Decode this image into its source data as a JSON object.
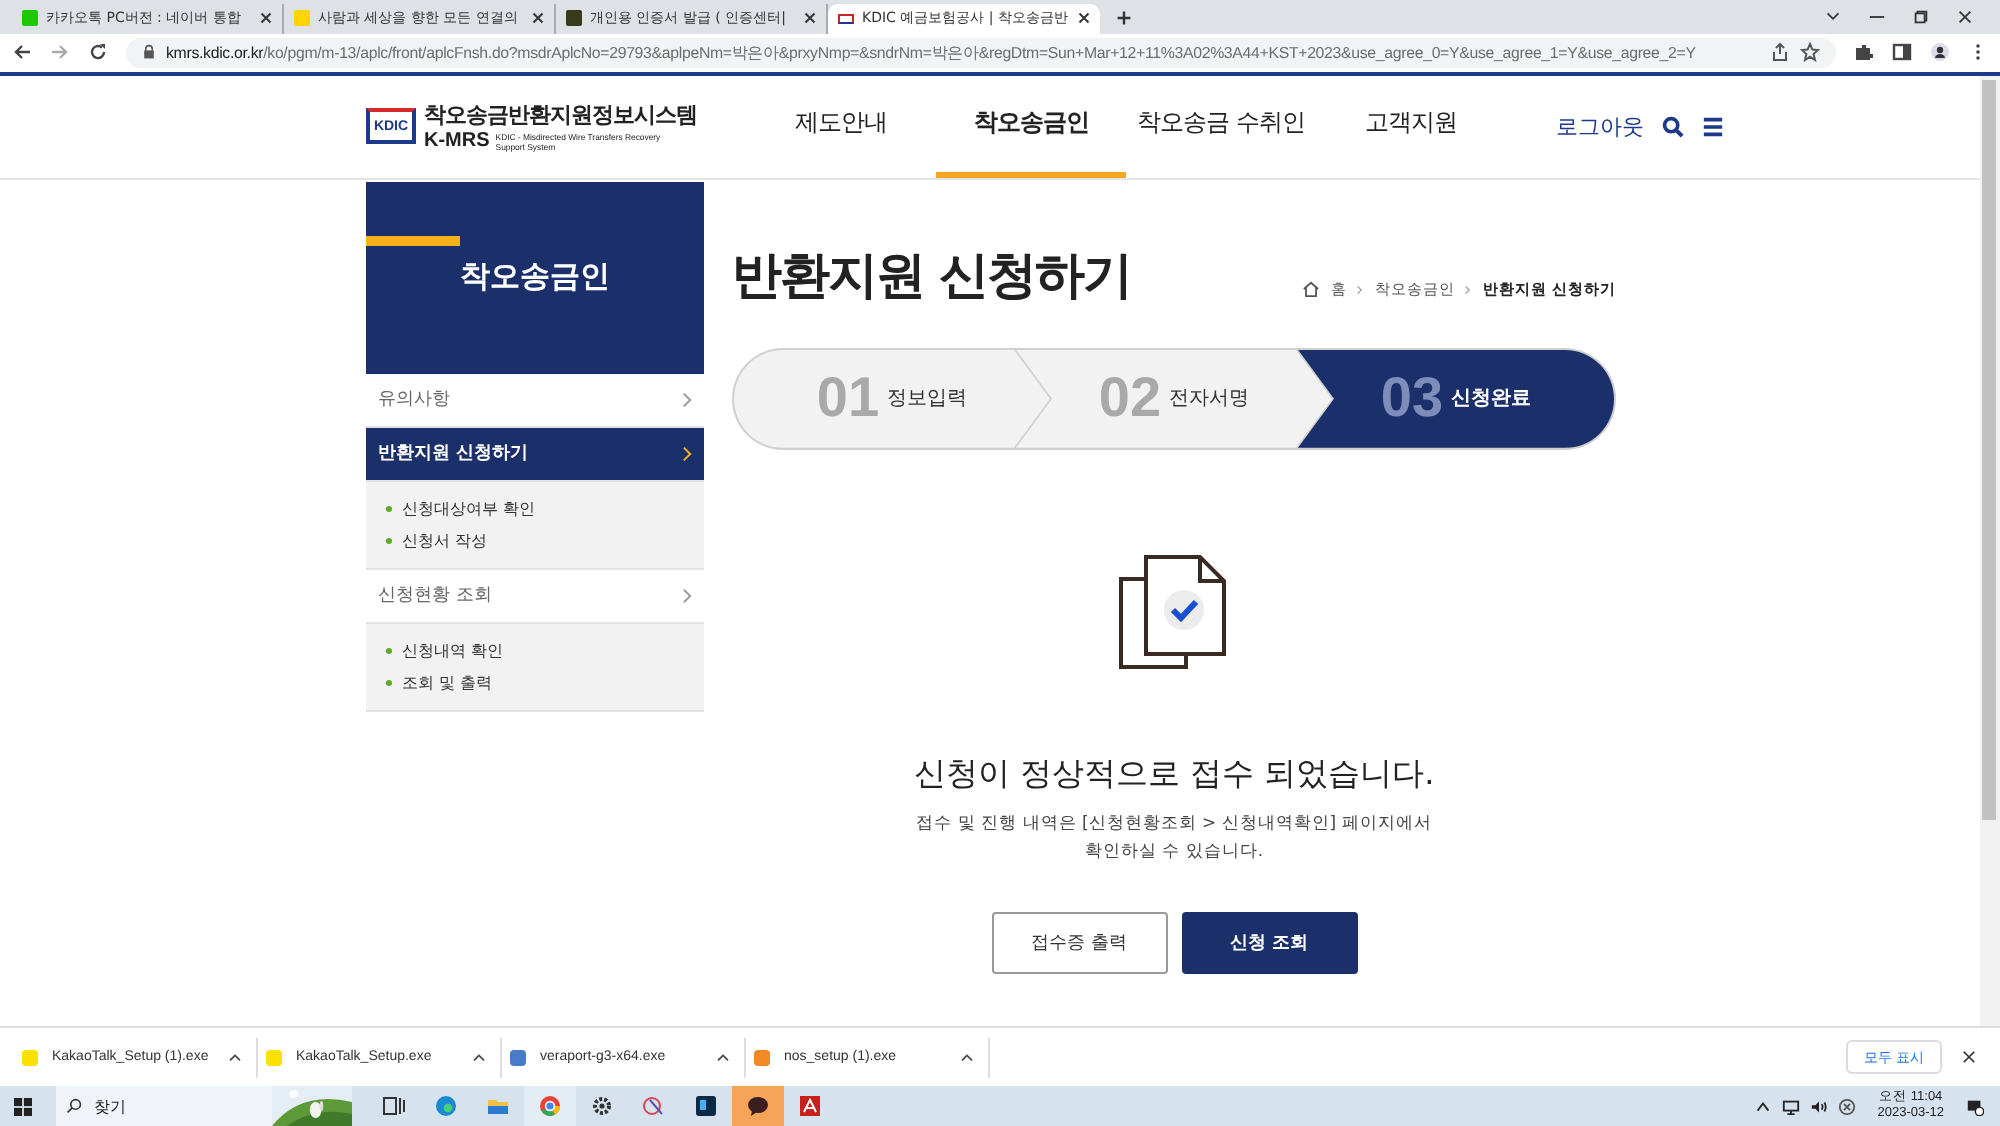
{
  "browser": {
    "tabs": [
      {
        "title": "카카오톡 PC버전 : 네이버 통합",
        "selected": false
      },
      {
        "title": "사람과 세상을 향한 모든 연결의",
        "selected": false
      },
      {
        "title": "개인용 인증서 발급 ( 인증센터|",
        "selected": false
      },
      {
        "title": "KDIC 예금보험공사 | 착오송금반",
        "selected": true
      }
    ],
    "url_host": "kmrs.kdic.or.kr",
    "url_path": "/ko/pgm/m-13/aplc/front/aplcFnsh.do?msdrAplcNo=29793&aplpeNm=박은아&prxyNmp=&sndrNm=박은아&regDtm=Sun+Mar+12+11%3A02%3A44+KST+2023&use_agree_0=Y&use_agree_1=Y&use_agree_2=Y"
  },
  "site": {
    "logo_mark": "KDIC",
    "logo_title": "착오송금반환지원정보시스템",
    "logo_abbr": "K-MRS",
    "logo_sub": "KDIC - Misdirected Wire Transfers Recovery Support System",
    "nav": [
      {
        "label": "제도안내",
        "selected": false
      },
      {
        "label": "착오송금인",
        "selected": true
      },
      {
        "label": "착오송금 수취인",
        "selected": false
      },
      {
        "label": "고객지원",
        "selected": false
      }
    ],
    "logout": "로그아웃"
  },
  "sidebar": {
    "title": "착오송금인",
    "items": [
      {
        "label": "유의사항",
        "selected": false
      },
      {
        "label": "반환지원 신청하기",
        "selected": true,
        "children": [
          "신청대상여부 확인",
          "신청서 작성"
        ]
      },
      {
        "label": "신청현황 조회",
        "selected": false,
        "children": [
          "신청내역 확인",
          "조회 및 출력"
        ]
      }
    ]
  },
  "main": {
    "title": "반환지원 신청하기",
    "breadcrumb": [
      "홈",
      "착오송금인",
      "반환지원 신청하기"
    ],
    "steps": [
      {
        "number": "01",
        "label": "정보입력",
        "selected": false
      },
      {
        "number": "02",
        "label": "전자서명",
        "selected": false
      },
      {
        "number": "03",
        "label": "신청완료",
        "selected": true
      }
    ],
    "message": "신청이 정상적으로 접수 되었습니다.",
    "note_lines": [
      "접수 및 진행 내역은 [신청현황조회 > 신청내역확인] 페이지에서",
      "확인하실 수 있습니다."
    ],
    "buttons": [
      {
        "label": "접수증 출력",
        "kind": "outline"
      },
      {
        "label": "신청 조회",
        "kind": "primary"
      }
    ]
  },
  "downloads": {
    "items": [
      {
        "name": "KakaoTalk_Setup (1).exe"
      },
      {
        "name": "KakaoTalk_Setup.exe"
      },
      {
        "name": "veraport-g3-x64.exe"
      },
      {
        "name": "nos_setup (1).exe"
      }
    ],
    "show_all": "모두 표시"
  },
  "taskbar": {
    "search": "찾기",
    "time": "오전 11:04",
    "date": "2023-03-12"
  }
}
